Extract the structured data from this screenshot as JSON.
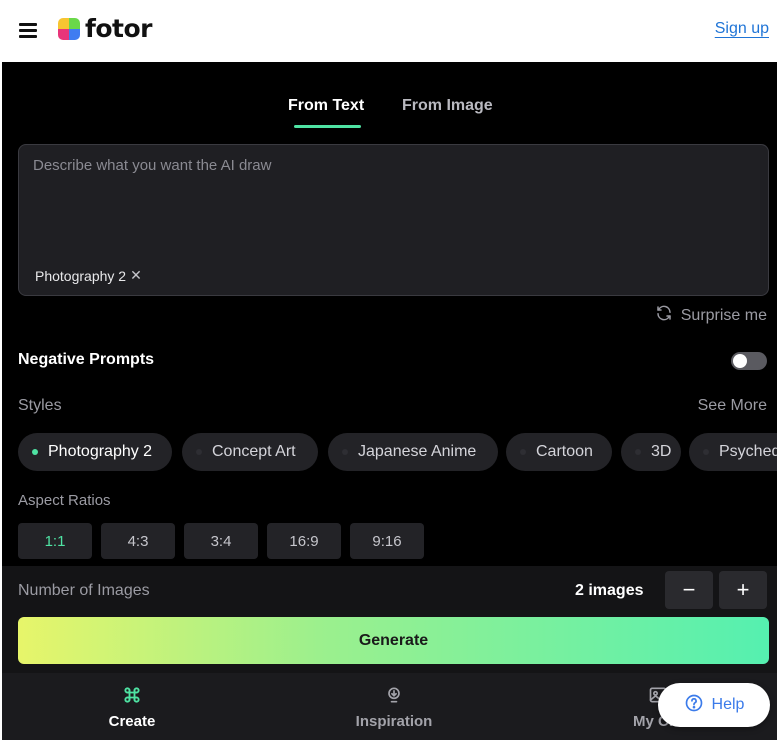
{
  "header": {
    "brand": "fotor",
    "signup_label": "Sign up"
  },
  "tabs": [
    {
      "label": "From Text",
      "active": true
    },
    {
      "label": "From Image",
      "active": false
    }
  ],
  "prompt": {
    "placeholder": "Describe what you want the AI draw",
    "value": "",
    "tag_label": "Photography 2"
  },
  "surprise_label": "Surprise me",
  "negative_prompts": {
    "label": "Negative Prompts",
    "enabled": false
  },
  "styles": {
    "label": "Styles",
    "see_more_label": "See More",
    "items": [
      {
        "label": "Photography 2",
        "active": true
      },
      {
        "label": "Concept Art",
        "active": false
      },
      {
        "label": "Japanese Anime",
        "active": false
      },
      {
        "label": "Cartoon",
        "active": false
      },
      {
        "label": "3D",
        "active": false
      },
      {
        "label": "Psyched",
        "active": false
      }
    ]
  },
  "aspect_ratios": {
    "label": "Aspect Ratios",
    "items": [
      {
        "label": "1:1",
        "active": true
      },
      {
        "label": "4:3",
        "active": false
      },
      {
        "label": "3:4",
        "active": false
      },
      {
        "label": "16:9",
        "active": false
      },
      {
        "label": "9:16",
        "active": false
      }
    ]
  },
  "number_of_images": {
    "label": "Number of Images",
    "value_label": "2 images",
    "minus": "−",
    "plus": "+"
  },
  "generate_label": "Generate",
  "nav": {
    "create": "Create",
    "inspiration": "Inspiration",
    "my_creations": "My Cre"
  },
  "help_label": "Help",
  "colors": {
    "accent": "#4fe3a3",
    "link": "#1f74d6",
    "help": "#3b7bea"
  }
}
